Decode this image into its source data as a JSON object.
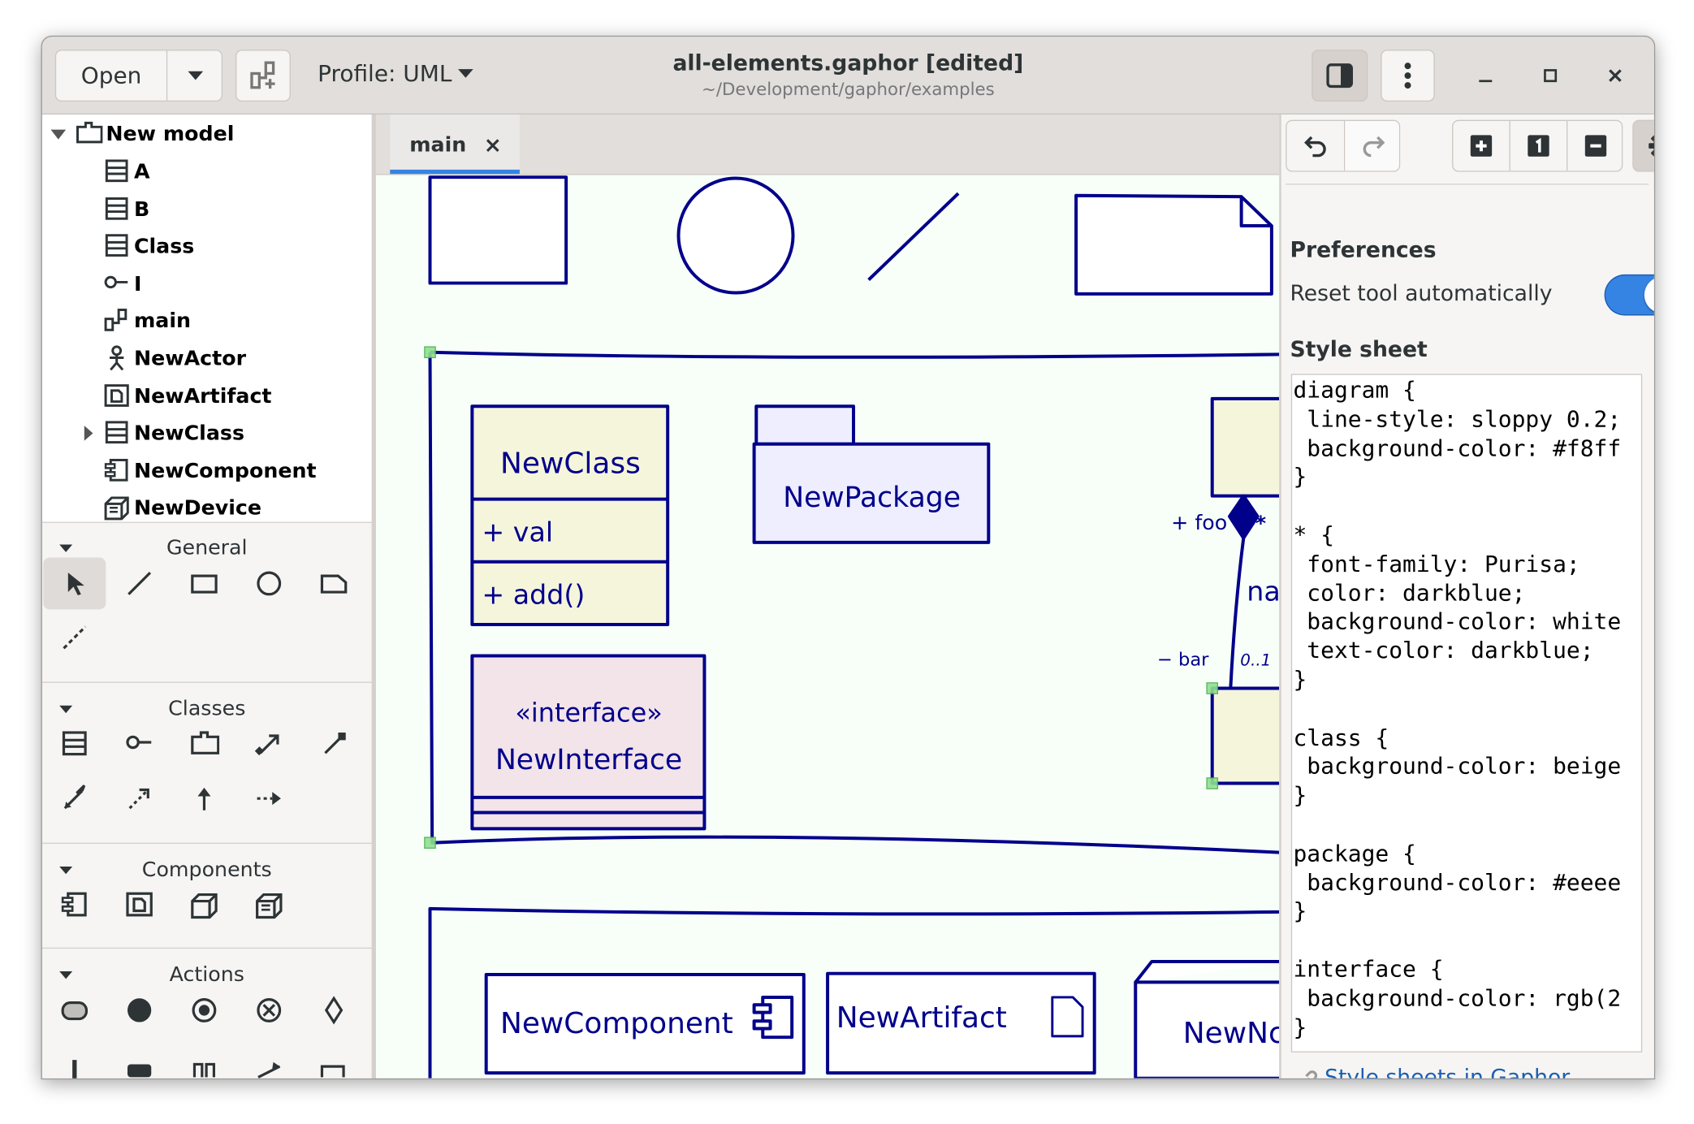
{
  "header": {
    "open_label": "Open",
    "profile_label": "Profile: UML",
    "title": "all-elements.gaphor [edited]",
    "subtitle": "~/Development/gaphor/examples"
  },
  "tree": {
    "root": {
      "label": "New model",
      "icon": "package-icon",
      "expanded": true
    },
    "items": [
      {
        "label": "A",
        "icon": "class-icon"
      },
      {
        "label": "B",
        "icon": "class-icon"
      },
      {
        "label": "Class",
        "icon": "class-icon"
      },
      {
        "label": "I",
        "icon": "interface-icon"
      },
      {
        "label": "main",
        "icon": "diagram-icon"
      },
      {
        "label": "NewActor",
        "icon": "actor-icon"
      },
      {
        "label": "NewArtifact",
        "icon": "artifact-icon"
      },
      {
        "label": "NewClass",
        "icon": "class-icon",
        "expandable": true
      },
      {
        "label": "NewComponent",
        "icon": "component-icon"
      },
      {
        "label": "NewDevice",
        "icon": "device-icon"
      }
    ]
  },
  "toolbox": {
    "sections": [
      {
        "title": "General",
        "tools": [
          "pointer-icon",
          "line-icon",
          "box-icon",
          "ellipse-icon",
          "comment-icon",
          "comment-line-icon"
        ]
      },
      {
        "title": "Classes",
        "tools": [
          "class-icon",
          "interface-icon",
          "package-icon",
          "association-icon",
          "shared-association-icon",
          "composite-association-icon",
          "dependency-icon",
          "generalization-icon",
          "realization-icon"
        ]
      },
      {
        "title": "Components",
        "tools": [
          "component-icon",
          "artifact-icon",
          "node-icon",
          "device-icon"
        ]
      },
      {
        "title": "Actions",
        "tools": [
          "action-icon",
          "initial-node-icon",
          "activity-final-icon",
          "flow-final-icon",
          "decision-node-icon",
          "fork-node-icon",
          "object-node-icon",
          "partition-icon",
          "send-signal-icon",
          "accept-event-icon"
        ]
      }
    ]
  },
  "tabs": [
    {
      "label": "main",
      "close": "×"
    }
  ],
  "diagram": {
    "new_class": {
      "name": "NewClass",
      "attribute": "+ val",
      "operation": "+ add()"
    },
    "new_package": {
      "name": "NewPackage"
    },
    "new_interface": {
      "stereotype": "«interface»",
      "name": "NewInterface"
    },
    "association": {
      "end_a_name": "+ foo",
      "end_a_mult": "*",
      "name": "na",
      "end_b_name": "− bar",
      "end_b_mult": "0..1"
    },
    "new_component": {
      "name": "NewComponent"
    },
    "new_artifact": {
      "name": "NewArtifact"
    },
    "new_node": {
      "name": "NewNc"
    }
  },
  "right_panel": {
    "preferences_title": "Preferences",
    "reset_label": "Reset tool automatically",
    "reset_enabled": true,
    "stylesheet_title": "Style sheet",
    "stylesheet_text": "diagram {\n line-style: sloppy 0.2;\n background-color: #f8ff\n}\n\n* {\n font-family: Purisa;\n color: darkblue;\n background-color: white\n text-color: darkblue;\n}\n\nclass {\n background-color: beige\n}\n\npackage {\n background-color: #eeee\n}\n\ninterface {\n background-color: rgb(2\n}",
    "link_label": "Style sheets in Gaphor"
  },
  "colors": {
    "accent": "#3584e4",
    "diagram_line": "#00008b",
    "diagram_background": "#f8fff8",
    "class_fill": "#f5f5dc",
    "package_fill": "#eeeeff",
    "interface_fill": "#f3e4ea",
    "handle": "#8fe08f"
  }
}
